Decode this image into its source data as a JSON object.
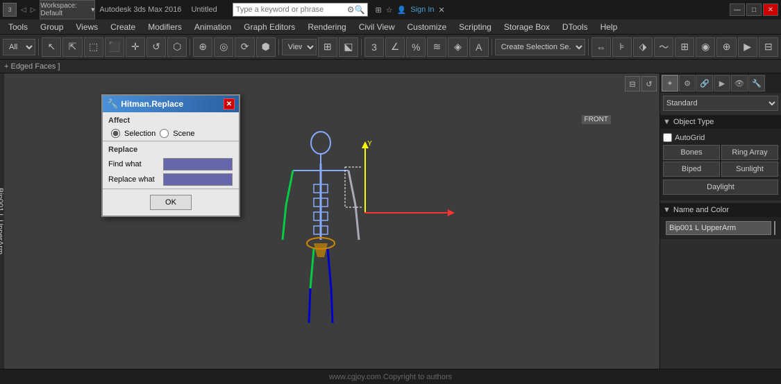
{
  "titlebar": {
    "workspace_label": "Workspace: Default",
    "app_name": "Autodesk 3ds Max 2016",
    "doc_name": "Untitled",
    "search_placeholder": "Type a keyword or phrase",
    "sign_in": "Sign In",
    "win_minimize": "—",
    "win_maximize": "□",
    "win_close": "✕"
  },
  "menubar": {
    "items": [
      "Tools",
      "Group",
      "Views",
      "Create",
      "Modifiers",
      "Animation",
      "Graph Editors",
      "Rendering",
      "Civil View",
      "Customize",
      "Scripting",
      "Storage Box",
      "DTools",
      "Help"
    ]
  },
  "toolbar": {
    "dropdown_all": "All",
    "dropdown_view": "View",
    "dropdown_selection": "Create Selection Se..."
  },
  "status_top": {
    "label": "+ Edged Faces ]"
  },
  "viewport": {
    "front_label": "FRONT",
    "object_label": "Bip001 L UpperArm"
  },
  "dialog": {
    "title": "Hitman.Replace",
    "affect_label": "Affect",
    "selection_label": "Selection",
    "scene_label": "Scene",
    "replace_label": "Replace",
    "find_what_label": "Find what",
    "replace_what_label": "Replace what",
    "ok_label": "OK"
  },
  "right_panel": {
    "standard_dropdown": "Standard",
    "object_type_header": "Object Type",
    "autogrid_label": "AutoGrid",
    "bones_label": "Bones",
    "ring_array_label": "Ring Array",
    "biped_label": "Biped",
    "sunlight_label": "Sunlight",
    "daylight_label": "Daylight",
    "name_color_header": "Name and Color",
    "object_name": "Bip001 L UpperArm",
    "color_value": "#0000ff"
  },
  "bottom_bar": {
    "copyright": "www.cgjoy.com  Copyright to authors"
  }
}
